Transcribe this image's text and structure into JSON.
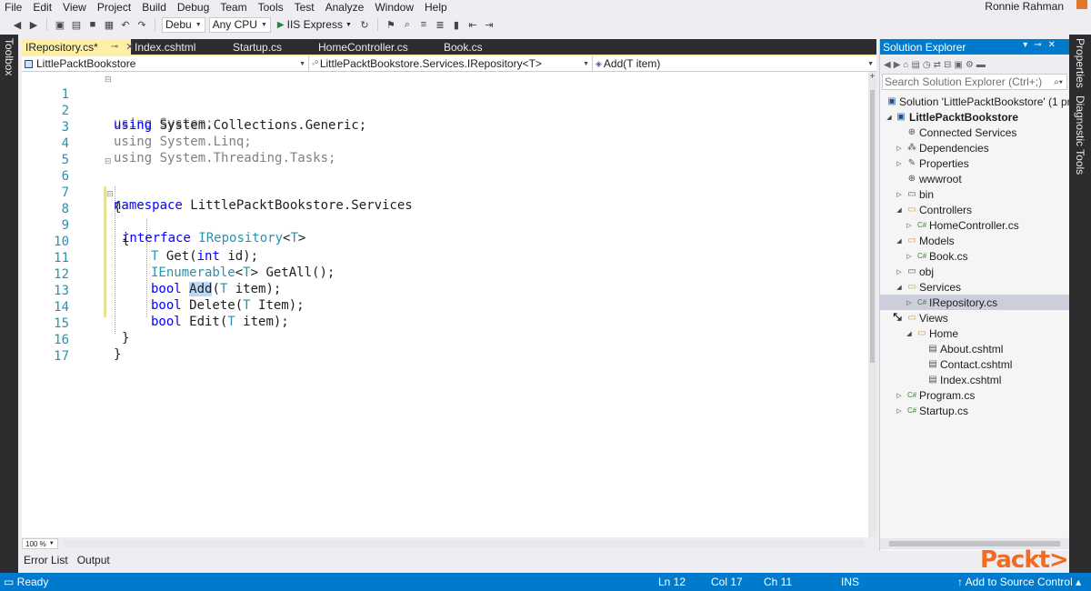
{
  "menu": [
    "File",
    "Edit",
    "View",
    "Project",
    "Build",
    "Debug",
    "Team",
    "Tools",
    "Test",
    "Analyze",
    "Window",
    "Help"
  ],
  "user": "Ronnie Rahman",
  "toolbar": {
    "config": "Debu",
    "platform": "Any CPU",
    "run_target": "IIS Express"
  },
  "left_strip_label": "Toolbox",
  "right_strip_labels": [
    "Properties",
    "Diagnostic Tools"
  ],
  "editor_tabs": [
    {
      "label": "IRepository.cs*",
      "active": true
    },
    {
      "label": "Index.cshtml",
      "active": false
    },
    {
      "label": "Startup.cs",
      "active": false
    },
    {
      "label": "HomeController.cs",
      "active": false
    },
    {
      "label": "Book.cs",
      "active": false
    }
  ],
  "navbar": {
    "project": "LittlePacktBookstore",
    "type": "LittlePacktBookstore.Services.IRepository<T>",
    "member": "Add(T item)"
  },
  "code_lines": [
    {
      "n": "1",
      "text": "using System;"
    },
    {
      "n": "2",
      "text": "using System.Collections.Generic;"
    },
    {
      "n": "3",
      "text": "using System.Linq;"
    },
    {
      "n": "4",
      "text": "using System.Threading.Tasks;"
    },
    {
      "n": "5",
      "text": ""
    },
    {
      "n": "6",
      "text": "namespace LittlePacktBookstore.Services"
    },
    {
      "n": "7",
      "text": "{"
    },
    {
      "n": "8",
      "text": "interface IRepository<T>"
    },
    {
      "n": "9",
      "text": "{"
    },
    {
      "n": "10",
      "text": "T Get(int id);"
    },
    {
      "n": "11",
      "text": "IEnumerable<T> GetAll();"
    },
    {
      "n": "12",
      "text": "bool Add(T item);"
    },
    {
      "n": "13",
      "text": "bool Delete(T Item);"
    },
    {
      "n": "14",
      "text": "bool Edit(T item);"
    },
    {
      "n": "15",
      "text": "}"
    },
    {
      "n": "16",
      "text": "}"
    },
    {
      "n": "17",
      "text": ""
    }
  ],
  "zoom": "100 %",
  "output_tabs": [
    "Error List",
    "Output"
  ],
  "solution_explorer": {
    "title": "Solution Explorer",
    "search_placeholder": "Search Solution Explorer (Ctrl+;)",
    "tree": [
      {
        "label": "Solution 'LittlePacktBookstore' (1 pr",
        "icon": "solution-icon"
      },
      {
        "label": "LittlePacktBookstore",
        "icon": "project-icon"
      },
      {
        "label": "Connected Services",
        "icon": "connected-services-icon"
      },
      {
        "label": "Dependencies",
        "icon": "dependencies-icon"
      },
      {
        "label": "Properties",
        "icon": "wrench-icon"
      },
      {
        "label": "wwwroot",
        "icon": "globe-icon"
      },
      {
        "label": "bin",
        "icon": "folder-icon"
      },
      {
        "label": "Controllers",
        "icon": "folder-icon"
      },
      {
        "label": "HomeController.cs",
        "icon": "csharp-file-icon"
      },
      {
        "label": "Models",
        "icon": "folder-icon"
      },
      {
        "label": "Book.cs",
        "icon": "csharp-file-icon"
      },
      {
        "label": "obj",
        "icon": "folder-icon"
      },
      {
        "label": "Services",
        "icon": "folder-icon"
      },
      {
        "label": "IRepository.cs",
        "icon": "csharp-file-icon"
      },
      {
        "label": "Views",
        "icon": "folder-icon"
      },
      {
        "label": "Home",
        "icon": "folder-icon"
      },
      {
        "label": "About.cshtml",
        "icon": "cshtml-file-icon"
      },
      {
        "label": "Contact.cshtml",
        "icon": "cshtml-file-icon"
      },
      {
        "label": "Index.cshtml",
        "icon": "cshtml-file-icon"
      },
      {
        "label": "Program.cs",
        "icon": "csharp-file-icon"
      },
      {
        "label": "Startup.cs",
        "icon": "csharp-file-icon"
      }
    ]
  },
  "status": {
    "state": "Ready",
    "line": "Ln 12",
    "col": "Col 17",
    "ch": "Ch 11",
    "mode": "INS",
    "source_control": "Add to Source Control"
  },
  "logo_text": "Packt>"
}
